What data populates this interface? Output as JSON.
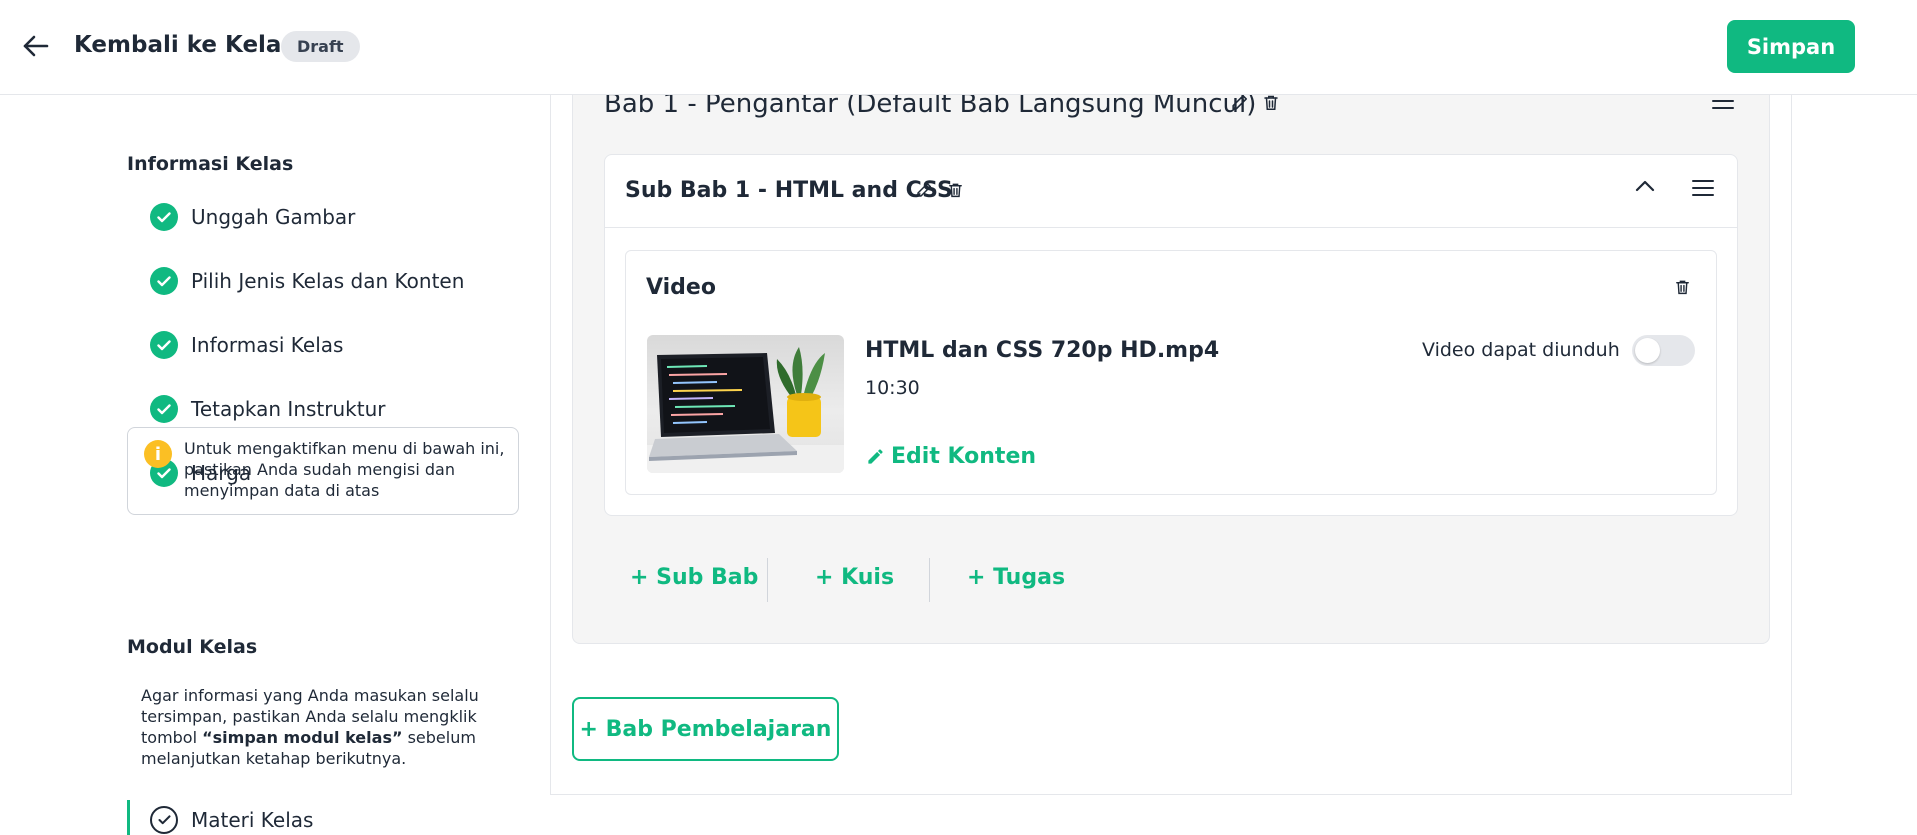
{
  "header": {
    "title": "Kembali ke Kelas",
    "status_badge": "Draft",
    "save_label": "Simpan"
  },
  "sidebar": {
    "info_section_title": "Informasi Kelas",
    "info_items": [
      {
        "label": "Unggah Gambar",
        "done": true
      },
      {
        "label": "Pilih Jenis Kelas dan Konten",
        "done": true
      },
      {
        "label": "Informasi Kelas",
        "done": true
      },
      {
        "label": "Tetapkan Instruktur",
        "done": true
      },
      {
        "label": "Harga",
        "done": true
      }
    ],
    "notice_text": "Untuk mengaktifkan menu di bawah ini, pastikan Anda sudah mengisi dan menyimpan data di atas",
    "modul_section_title": "Modul Kelas",
    "modul_desc_before": "Agar informasi yang Anda masukan selalu tersimpan, pastikan Anda selalu mengklik tombol ",
    "modul_desc_bold": "“simpan modul kelas”",
    "modul_desc_after": " sebelum melanjutkan ketahap berikutnya.",
    "materi_label": "Materi Kelas"
  },
  "bab": {
    "title": "Bab 1  - Pengantar (Default Bab Langsung Muncul)",
    "subbab": {
      "title": "Sub Bab 1 - HTML and CSS",
      "content": {
        "type_label": "Video",
        "file_name": "HTML dan CSS 720p HD.mp4",
        "duration": "10:30",
        "edit_label": "Edit Konten",
        "download_label": "Video dapat diunduh",
        "download_enabled": false
      }
    },
    "add_sub_bab": "+ Sub Bab",
    "add_kuis": "+ Kuis",
    "add_tugas": "+ Tugas"
  },
  "add_bab_label": "+ Bab Pembelajaran",
  "colors": {
    "accent": "#10b981",
    "warning": "#fbbf24",
    "badge_bg": "#e5e7eb"
  },
  "icons": [
    "arrow-left-icon",
    "check-icon",
    "info-icon",
    "pencil-icon",
    "trash-icon",
    "menu-icon",
    "chevron-up-icon"
  ]
}
